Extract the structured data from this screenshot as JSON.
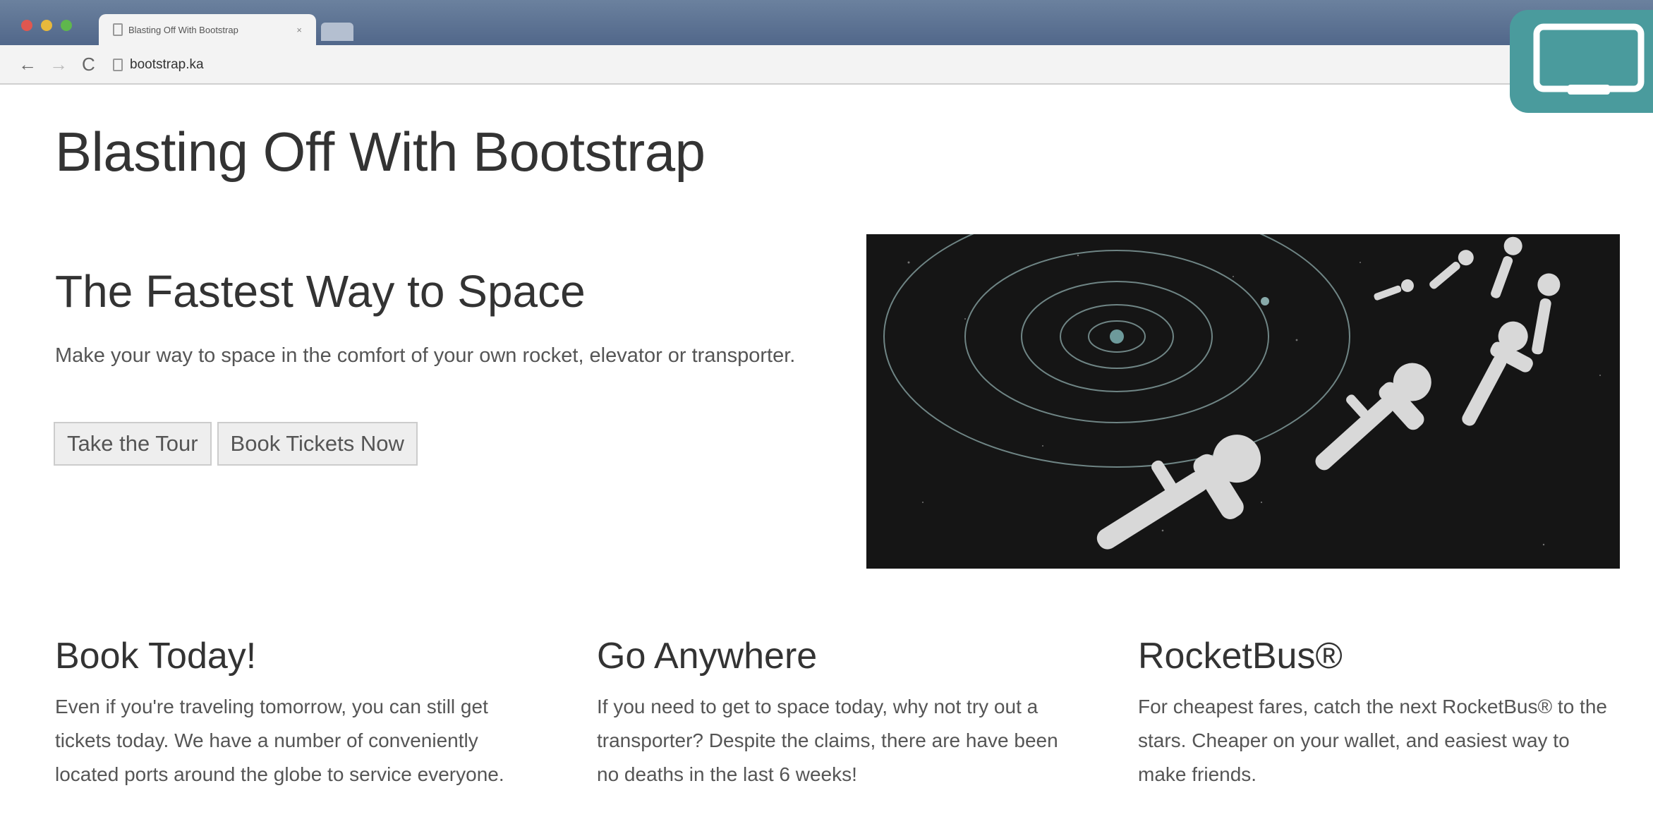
{
  "browser": {
    "tab_title": "Blasting Off With Bootstrap",
    "tab_close": "×",
    "url": "bootstrap.ka",
    "nav": {
      "back": "←",
      "forward": "→",
      "reload": "C"
    }
  },
  "page": {
    "title": "Blasting Off With Bootstrap",
    "hero": {
      "heading": "The Fastest Way to Space",
      "text": "Make your way to space in the comfort of your own rocket, elevator or transporter.",
      "buttons": [
        "Take the Tour",
        "Book Tickets Now"
      ]
    },
    "columns": [
      {
        "heading": "Book Today!",
        "text": "Even if you're traveling tomorrow, you can still get tickets today. We have a number of conveniently located ports around the globe to service everyone."
      },
      {
        "heading": "Go Anywhere",
        "text": "If you need to get to space today, why not try out a transporter? Despite the claims, there are have been no deaths in the last 6 weeks!"
      },
      {
        "heading": "RocketBus®",
        "text": "For cheapest fares, catch the next RocketBus® to the stars. Cheaper on your wallet, and easiest way to make friends."
      }
    ]
  },
  "icons": {
    "corner": "laptop-icon",
    "page": "page-icon",
    "hero_image": "astronauts-solar-system-illustration"
  },
  "colors": {
    "tabbar": "#51678a",
    "corner_badge": "#4a9b9d",
    "text": "#333333",
    "body_text": "#555555",
    "button_bg": "#eeeeee"
  }
}
